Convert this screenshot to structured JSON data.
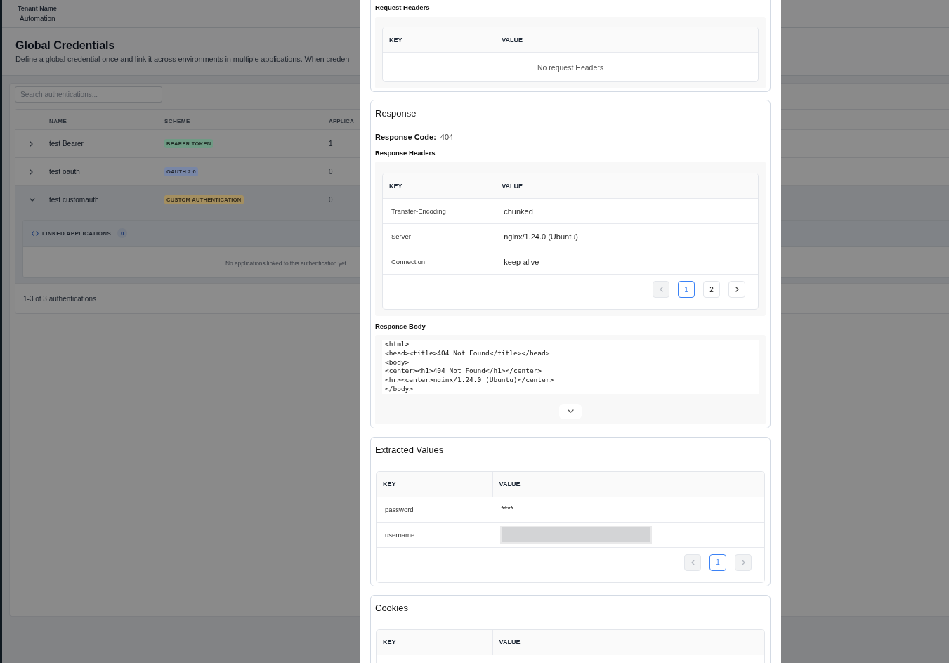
{
  "app": {
    "header": {
      "label": "Tenant Name",
      "value": "Automation"
    },
    "title": "Global Credentials",
    "description": "Define a global credential once and link it across environments in multiple applications. When creden",
    "search": {
      "placeholder": "Search authentications..."
    },
    "table": {
      "columns": [
        "NAME",
        "SCHEME",
        "APPLICA"
      ],
      "rows": [
        {
          "name": "test Bearer",
          "scheme": "BEARER TOKEN",
          "color": "#6f9a84",
          "applications": "1",
          "linked": true,
          "expanded": false
        },
        {
          "name": "test oauth",
          "scheme": "OAUTH 2.0",
          "color": "#7886a6",
          "applications": "0",
          "linked": false,
          "expanded": false
        },
        {
          "name": "test customauth",
          "scheme": "CUSTOM AUTHENTICATION",
          "color": "#a48f60",
          "applications": "0",
          "linked": false,
          "expanded": true,
          "linked_panel": {
            "title": "LINKED APPLICATIONS",
            "count": "0",
            "empty_text": "No applications linked to this authentication yet."
          }
        }
      ]
    },
    "footer": "1-3 of 3 authentications"
  },
  "sheet": {
    "request": {
      "headers_label": "Request Headers",
      "headers": {
        "columns": [
          "KEY",
          "VALUE"
        ],
        "empty_text": "No request Headers"
      }
    },
    "response": {
      "title": "Response",
      "code_label": "Response Code:",
      "code": "404",
      "headers_label": "Response Headers",
      "headers": {
        "columns": [
          "KEY",
          "VALUE"
        ],
        "rows": [
          {
            "key": "Transfer-Encoding",
            "value": "chunked"
          },
          {
            "key": "Server",
            "value": "nginx/1.24.0 (Ubuntu)"
          },
          {
            "key": "Connection",
            "value": "keep-alive"
          }
        ],
        "pagination": {
          "prev_disabled": true,
          "pages": [
            {
              "label": "1",
              "selected": true
            },
            {
              "label": "2",
              "selected": false
            }
          ],
          "next_disabled": false
        }
      },
      "body_label": "Response Body",
      "body": "<html>\n<head><title>404 Not Found</title></head>\n<body>\n<center><h1>404 Not Found</h1></center>\n<hr><center>nginx/1.24.0 (Ubuntu)</center>\n</body>",
      "body_expanded": false
    },
    "extracted_values": {
      "title": "Extracted Values",
      "table": {
        "columns": [
          "KEY",
          "VALUE"
        ],
        "rows": [
          {
            "key": "password",
            "value": "****",
            "masked": false
          },
          {
            "key": "username",
            "masked": true
          }
        ],
        "pagination": {
          "prev_disabled": true,
          "pages": [
            {
              "label": "1",
              "selected": true
            }
          ],
          "next_disabled": true
        }
      }
    },
    "cookies": {
      "title": "Cookies",
      "table": {
        "columns": [
          "KEY",
          "VALUE"
        ]
      }
    }
  }
}
